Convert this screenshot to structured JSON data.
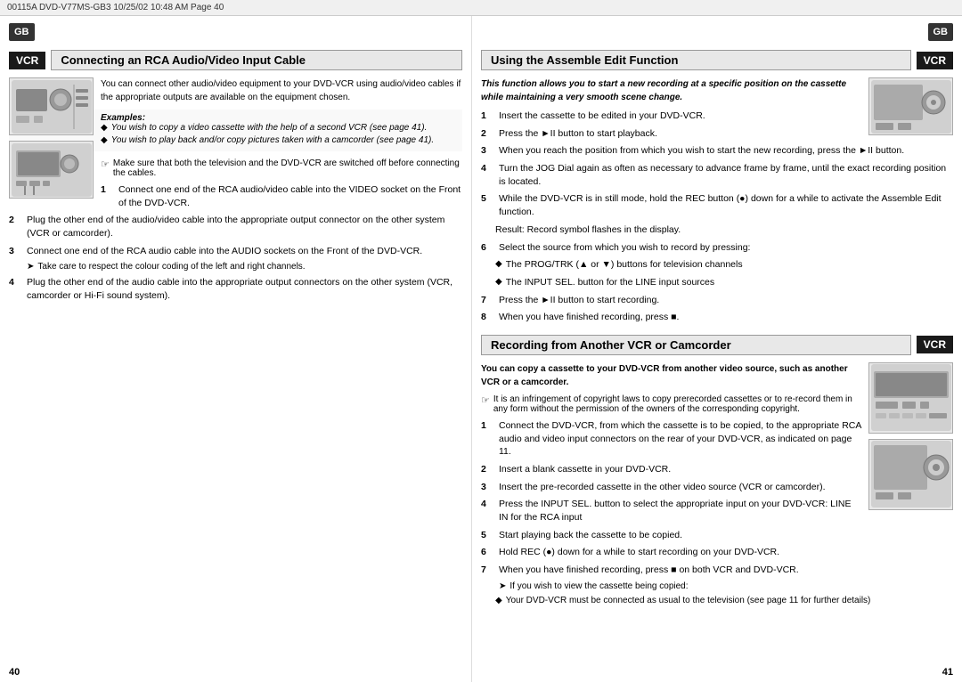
{
  "header": {
    "text": "00115A  DVD-V77MS-GB3   10/25/02  10:48 AM   Page 40"
  },
  "left_page": {
    "page_number": "40",
    "gb_badge": "GB",
    "vcr_badge": "VCR",
    "section_title": "Connecting an RCA Audio/Video Input Cable",
    "intro_text": "You can connect other audio/video equipment to your DVD-VCR using audio/video cables if the appropriate outputs are available on the equipment chosen.",
    "examples_label": "Examples:",
    "examples": [
      "You wish to copy a video cassette with the help of a second VCR (see page 41).",
      "You wish to play back and/or copy pictures taken with a camcorder (see page 41)."
    ],
    "tip_text": "Make sure that both the television and the DVD-VCR are switched off before connecting the cables.",
    "steps": [
      {
        "num": "1",
        "text": "Connect one end of the RCA audio/video cable into the VIDEO socket on the Front of the DVD-VCR."
      },
      {
        "num": "2",
        "text": "Plug the other end of the audio/video cable into the appropriate output connector on the other system (VCR or camcorder)."
      },
      {
        "num": "3",
        "text": "Connect one end of the RCA audio cable into the AUDIO sockets on the Front of the DVD-VCR."
      },
      {
        "num": "4",
        "text": "Plug the other end of the audio cable into the appropriate output connectors on the other system (VCR, camcorder or Hi-Fi sound system)."
      }
    ],
    "arrow_note": "Take care to respect the colour coding of the left and right channels."
  },
  "right_page": {
    "page_number": "41",
    "gb_badge": "GB",
    "section1": {
      "vcr_badge": "VCR",
      "title": "Using the Assemble Edit Function",
      "intro_bold_italic": "This function allows you to start a new recording at a specific position on the cassette while maintaining a very smooth scene change.",
      "steps": [
        {
          "num": "1",
          "text": "Insert the cassette to be edited in your DVD-VCR."
        },
        {
          "num": "2",
          "text": "Press the ►II button to start playback."
        },
        {
          "num": "3",
          "text": "When you reach the position from which you wish to start the new recording, press the ►II button."
        },
        {
          "num": "4",
          "text": "Turn the JOG Dial again as often as necessary to advance frame by frame, until the exact recording position is located."
        },
        {
          "num": "5",
          "text": "While the DVD-VCR is in still mode, hold the REC button (●) down for a while to activate the Assemble Edit function."
        },
        {
          "num": "5_result",
          "text": "Result:   Record symbol flashes in the display."
        },
        {
          "num": "6",
          "text": "Select the source from which you wish to record by pressing:"
        },
        {
          "num": "6a",
          "text": "The PROG/TRK (▲ or ▼) buttons for television channels"
        },
        {
          "num": "6b",
          "text": "The INPUT SEL. button for the LINE input sources"
        },
        {
          "num": "7",
          "text": "Press the ►II button to start recording."
        },
        {
          "num": "8",
          "text": "When you have finished recording, press ■."
        }
      ]
    },
    "section2": {
      "vcr_badge": "VCR",
      "title": "Recording from Another VCR or Camcorder",
      "intro_bold": "You can copy a cassette to your DVD-VCR from another video source, such as another VCR or a camcorder.",
      "tip_text": "It is an infringement of copyright laws to copy prerecorded cassettes or to re-record them in any form without the permission of the owners of the corresponding copyright.",
      "steps": [
        {
          "num": "1",
          "text": "Connect the DVD-VCR, from which the cassette is to be copied, to the appropriate RCA audio and video input connectors on the rear of your DVD-VCR, as indicated on page 11."
        },
        {
          "num": "2",
          "text": "Insert a blank cassette in your DVD-VCR."
        },
        {
          "num": "3",
          "text": "Insert the pre-recorded cassette in the other video source (VCR or camcorder)."
        },
        {
          "num": "4",
          "text": "Press the INPUT SEL. button to select the appropriate input on your DVD-VCR: LINE IN for the RCA input"
        },
        {
          "num": "5",
          "text": "Start playing back the cassette to be copied."
        },
        {
          "num": "6",
          "text": "Hold REC (●) down for a while to start recording on your DVD-VCR."
        },
        {
          "num": "7",
          "text": "When you have finished recording, press ■ on both VCR and DVD-VCR."
        }
      ],
      "arrow_note": "If you wish to view the cassette being copied:",
      "arrow_sub": "Your DVD-VCR must be connected as usual to the television (see page 11 for further details)"
    }
  }
}
